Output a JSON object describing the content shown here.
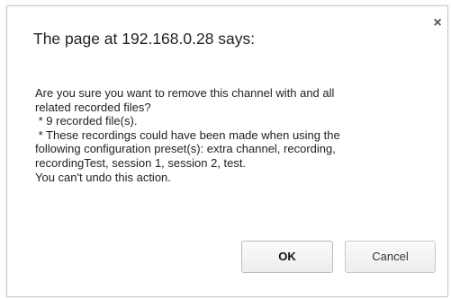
{
  "dialog": {
    "title": "The page at 192.168.0.28 says:",
    "close_label": "×",
    "message_lines": [
      "Are you sure you want to remove this channel with and all",
      "related recorded files?",
      " * 9 recorded file(s).",
      " * These recordings could have been made when using the",
      "following configuration preset(s): extra channel, recording,",
      "recordingTest, session 1, session 2, test.",
      "You can't undo this action."
    ],
    "ok_label": "OK",
    "cancel_label": "Cancel"
  }
}
